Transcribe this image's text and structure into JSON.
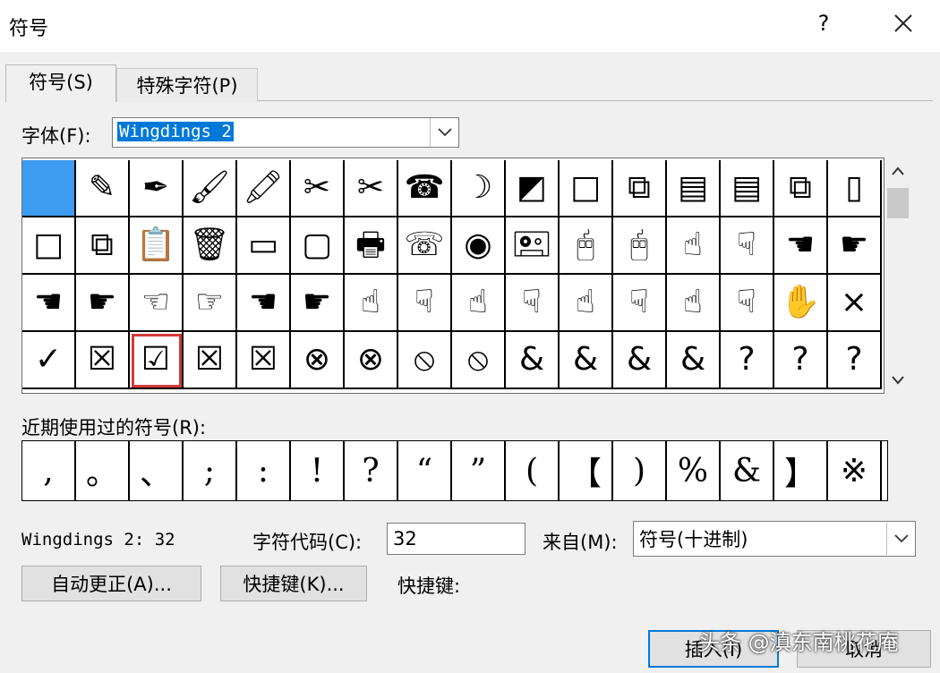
{
  "dialog": {
    "title": "符号",
    "help": "?",
    "close": "✕"
  },
  "tabs": [
    {
      "label": "符号(S)"
    },
    {
      "label": "特殊字符(P)"
    }
  ],
  "font": {
    "label": "字体(F):",
    "value": "Wingdings 2"
  },
  "grid": {
    "rows": [
      [
        "■",
        "✎",
        "✒",
        "🖌",
        "🖍",
        "✂",
        "✂",
        "☎",
        "☽",
        "◩",
        "□",
        "⧉",
        "▤",
        "▤",
        "⧉",
        "▯"
      ],
      [
        "□",
        "⧉",
        "📋",
        "🗑",
        "▭",
        "▢",
        "🖶",
        "☏",
        "◉",
        "🖭",
        "🖰",
        "🖰",
        "☝",
        "☟",
        "☚",
        "☛"
      ],
      [
        "☚",
        "☛",
        "☜",
        "☞",
        "☚",
        "☛",
        "☝",
        "☟",
        "☝",
        "☟",
        "☝",
        "☟",
        "☝",
        "☟",
        "✋",
        "×"
      ],
      [
        "✓",
        "☒",
        "☑",
        "☒",
        "☒",
        "⊗",
        "⊗",
        "⦸",
        "⦸",
        "&",
        "&",
        "&",
        "&",
        "?",
        "?",
        "?"
      ]
    ],
    "selected_index": 0,
    "focused_index": 50
  },
  "recent": {
    "label": "近期使用过的符号(R):",
    "symbols": [
      ",",
      "。",
      "、",
      ";",
      ":",
      "!",
      "?",
      "“",
      "”",
      "(",
      "【",
      ")",
      "%",
      "&",
      "】",
      "※"
    ]
  },
  "info": {
    "font_code": "Wingdings 2: 32",
    "char_code_label": "字符代码(C):",
    "char_code_value": "32",
    "from_label": "来自(M):",
    "from_value": "符号(十进制)"
  },
  "buttons": {
    "autocorrect": "自动更正(A)...",
    "shortcut_key": "快捷键(K)...",
    "shortcut_label": "快捷键:",
    "insert": "插入(I)",
    "cancel": "取消"
  },
  "watermark": "头条 @滇东南桃花庵"
}
